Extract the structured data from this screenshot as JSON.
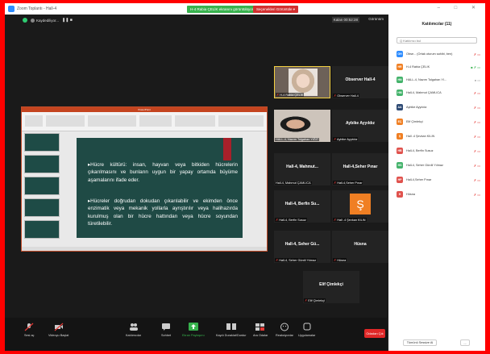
{
  "window": {
    "title": "Zoom Toplantı - Hall-4",
    "share_banner": "H-4 Rabia ÇELİK ekranını görüntülüyorsunuz",
    "view_options": "Seçenekleri Görüntüle ▾"
  },
  "meeting_top": {
    "recording": "Kaydediliyor...",
    "talk_time": "Kalan 00:52:28",
    "gallery": "Görünüm"
  },
  "slide": {
    "bullet1": "▸Hücre kültürü: insan, hayvan veya bitkiden hücrelerin çıkarılmasını ve bunların uygun bir yapay ortamda büyüme aşamalarını ifade eder.",
    "bullet2": "▸Hücreler doğrudan dokudan çıkarılabilir ve ekimden önce enzimatik veya mekanik yollarla ayrıştırılır veya halihazırda kurulmuş olan bir hücre hattından veya hücre soyundan türetilebilir."
  },
  "tiles": [
    {
      "name": "",
      "label": "H-4 Rabia ÇELİK"
    },
    {
      "name": "Observer Hall-4",
      "label": "Observer Hall-4"
    },
    {
      "name": "",
      "label": "HALL-4, Nazım Tolgahan YİĞİT"
    },
    {
      "name": "Aybike Ayyıldız",
      "label": "Aybike Ayyıldız"
    },
    {
      "name": "Hall-4, Mahmut...",
      "label": "Hall-4, Mahmut ÇAMLICA"
    },
    {
      "name": "Hall-4,Seher Pınar",
      "label": "Hall-4,Seher Pınar"
    },
    {
      "name": "Hall-4, Berfin Su...",
      "label": "Hall-4, Berfin Susuz"
    },
    {
      "name": "",
      "label": "Hall -4 Şevkan KILIN",
      "avatar": "Ş"
    },
    {
      "name": "Hall-4, Seher Gü...",
      "label": "Hall-4, Seher Gürdil Yılmaz"
    },
    {
      "name": "Hüsna",
      "label": "Hüsna"
    },
    {
      "name": "Elif Çimlekçi",
      "label": "Elif Çimlekçi"
    }
  ],
  "toolbar": {
    "audio": "Sesi aç",
    "video": "Videoyu Başlat",
    "participants": "Katılımcılar",
    "chat": "Sohbet",
    "share": "Ekran Paylaşımı",
    "record": "Kaydı Duraklat/Durdur",
    "rooms": "Ara Odalar",
    "reactions": "Reaksiyonlar",
    "apps": "Uygulamalar",
    "end": "Odadan Çık",
    "participant_count": "11",
    "rooms_badge": "2"
  },
  "panel": {
    "title": "Katılımcılar (11)",
    "search_placeholder": "Q Katılımcı bul",
    "participants": [
      {
        "initials": "OH",
        "name": "Obse... (Ortak oturum sahibi, ben)",
        "color": "#2d8cff"
      },
      {
        "initials": "HR",
        "name": "H-4 Rabia ÇELİK",
        "color": "#f07f23"
      },
      {
        "initials": "HN",
        "name": "HALL-4, Nazım Tolgahan Yİ...",
        "color": "#44b36b"
      },
      {
        "initials": "HM",
        "name": "Hall-4, Mahmut ÇAMLICA",
        "color": "#44b36b"
      },
      {
        "initials": "AA",
        "name": "Aybike Ayyıldız",
        "color": "#2e4a74"
      },
      {
        "initials": "EÇ",
        "name": "Elif Çimlekçi",
        "color": "#f07f23"
      },
      {
        "initials": "Ş",
        "name": "Hall -4 Şevkan KILIN",
        "color": "#f07f23"
      },
      {
        "initials": "HB",
        "name": "Hall-4, Berfin Susuz",
        "color": "#e0524d"
      },
      {
        "initials": "HS",
        "name": "Hall-4, Seher Gürdil Yılmaz",
        "color": "#44b36b"
      },
      {
        "initials": "HP",
        "name": "Hall-4,Seher Pınar",
        "color": "#e0524d"
      },
      {
        "initials": "H",
        "name": "Hüsna",
        "color": "#e0524d"
      }
    ],
    "mute_all": "Tümünü Sessize Al",
    "more": "..."
  },
  "colors": {
    "accent": "#2d8cff",
    "danger": "#e02828",
    "banner": "#37b24d",
    "slide_bg": "#1f4a45"
  }
}
